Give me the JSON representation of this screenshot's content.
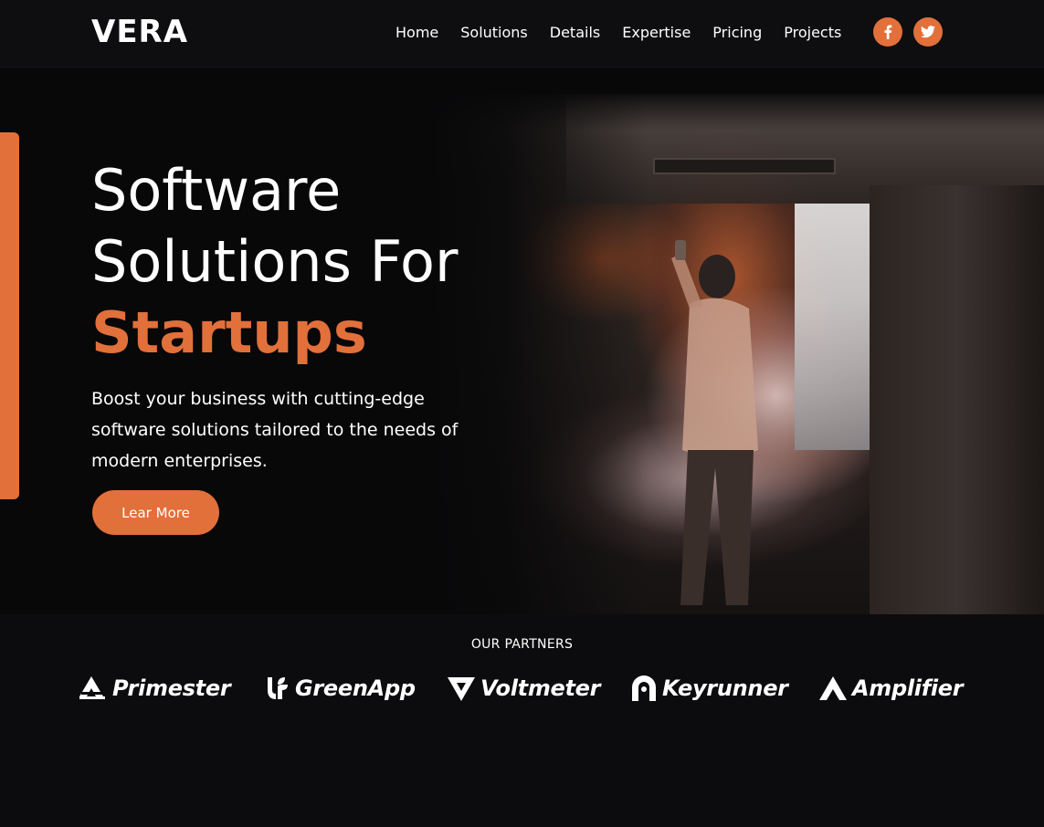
{
  "brand": {
    "name": "VERA"
  },
  "nav": {
    "items": [
      "Home",
      "Solutions",
      "Details",
      "Expertise",
      "Pricing",
      "Projects"
    ]
  },
  "socials": [
    {
      "icon": "facebook-icon"
    },
    {
      "icon": "twitter-icon"
    }
  ],
  "hero": {
    "title_line1": "Software",
    "title_line2": "Solutions For",
    "title_accent": "Startups",
    "description": "Boost your business with cutting-edge software solutions tailored to the needs of modern enterprises.",
    "cta_label": "Lear More"
  },
  "partners": {
    "title": "OUR PARTNERS",
    "items": [
      {
        "name": "Primester",
        "icon": "primester-logo-icon"
      },
      {
        "name": "GreenApp",
        "icon": "greenapp-logo-icon"
      },
      {
        "name": "Voltmeter",
        "icon": "voltmeter-logo-icon"
      },
      {
        "name": "Keyrunner",
        "icon": "keyrunner-logo-icon"
      },
      {
        "name": "Amplifier",
        "icon": "amplifier-logo-icon"
      }
    ]
  },
  "colors": {
    "accent": "#e2703a",
    "background": "#0b0b0d",
    "header": "#0e0e10",
    "text": "#ffffff"
  }
}
